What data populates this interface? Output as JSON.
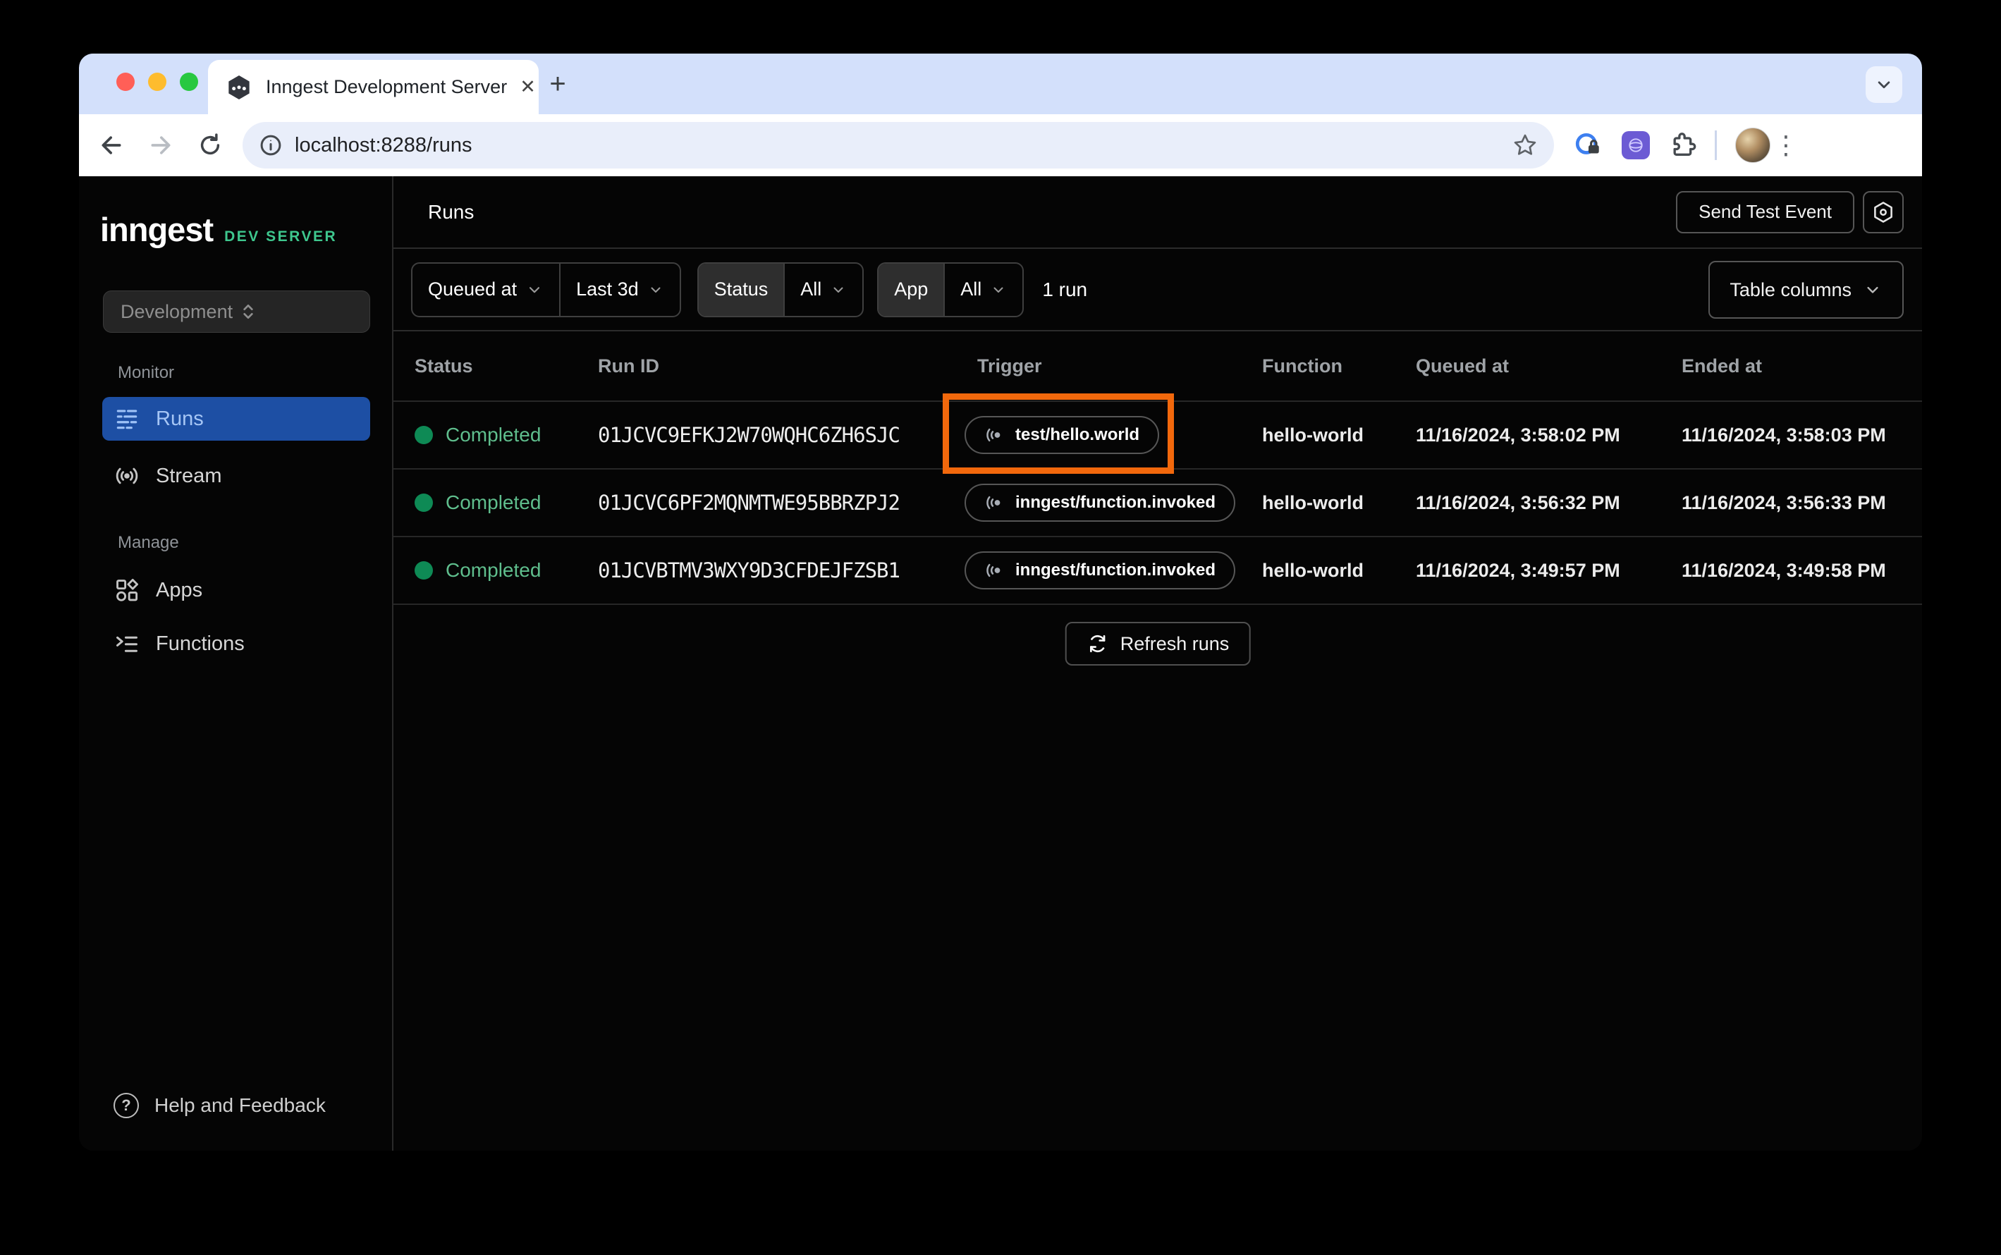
{
  "browser": {
    "tab_title": "Inngest Development Server",
    "url": "localhost:8288/runs"
  },
  "glyphs": {
    "close_tab": "✕",
    "new_tab": "+",
    "overflow_menu": "⋮",
    "question_mark": "?"
  },
  "sidebar": {
    "logo_text": "inngest",
    "badge": "DEV SERVER",
    "env_selector": "Development",
    "sections": [
      {
        "label": "Monitor",
        "items": [
          {
            "label": "Runs",
            "active": true
          },
          {
            "label": "Stream",
            "active": false
          }
        ]
      },
      {
        "label": "Manage",
        "items": [
          {
            "label": "Apps",
            "active": false
          },
          {
            "label": "Functions",
            "active": false
          }
        ]
      }
    ],
    "help_label": "Help and Feedback"
  },
  "header": {
    "title": "Runs",
    "send_test_event_label": "Send Test Event"
  },
  "filters": {
    "queued_at_label": "Queued at",
    "range_value": "Last 3d",
    "status_label": "Status",
    "status_value": "All",
    "app_label": "App",
    "app_value": "All",
    "run_count": "1 run",
    "table_columns_label": "Table columns"
  },
  "table": {
    "columns": [
      "Status",
      "Run ID",
      "Trigger",
      "Function",
      "Queued at",
      "Ended at"
    ],
    "rows": [
      {
        "status": "Completed",
        "run_id": "01JCVC9EFKJ2W70WQHC6ZH6SJC",
        "trigger": "test/hello.world",
        "function": "hello-world",
        "queued_at": "11/16/2024, 3:58:02 PM",
        "ended_at": "11/16/2024, 3:58:03 PM",
        "highlighted": true
      },
      {
        "status": "Completed",
        "run_id": "01JCVC6PF2MQNMTWE95BBRZPJ2",
        "trigger": "inngest/function.invoked",
        "function": "hello-world",
        "queued_at": "11/16/2024, 3:56:32 PM",
        "ended_at": "11/16/2024, 3:56:33 PM",
        "highlighted": false
      },
      {
        "status": "Completed",
        "run_id": "01JCVBTMV3WXY9D3CFDEJFZSB1",
        "trigger": "inngest/function.invoked",
        "function": "hello-world",
        "queued_at": "11/16/2024, 3:49:57 PM",
        "ended_at": "11/16/2024, 3:49:58 PM",
        "highlighted": false
      }
    ],
    "highlight": {
      "row": 0,
      "column": "Trigger"
    },
    "refresh_label": "Refresh runs"
  },
  "icons": {
    "favicon": "inngest-hexagon",
    "runs": "run-list-icon",
    "stream": "broadcast-icon",
    "apps": "app-grid-icon",
    "functions": "function-list-icon",
    "help": "question-circle-icon",
    "settings": "gear-hexagon-icon",
    "trigger": "event-pulse-icon",
    "refresh": "refresh-arrows-icon"
  },
  "colors": {
    "accent_orange": "#F2680C",
    "active_item_bg": "#1D4FA4",
    "active_item_fg": "#A6C6F5",
    "status_dot": "#0E8A55",
    "status_text": "#5FBE8D",
    "brand_green": "#3EC78E",
    "chrome_strip": "#D3E0FB",
    "url_pill": "#E9EEFA",
    "app_bg": "#050505"
  }
}
